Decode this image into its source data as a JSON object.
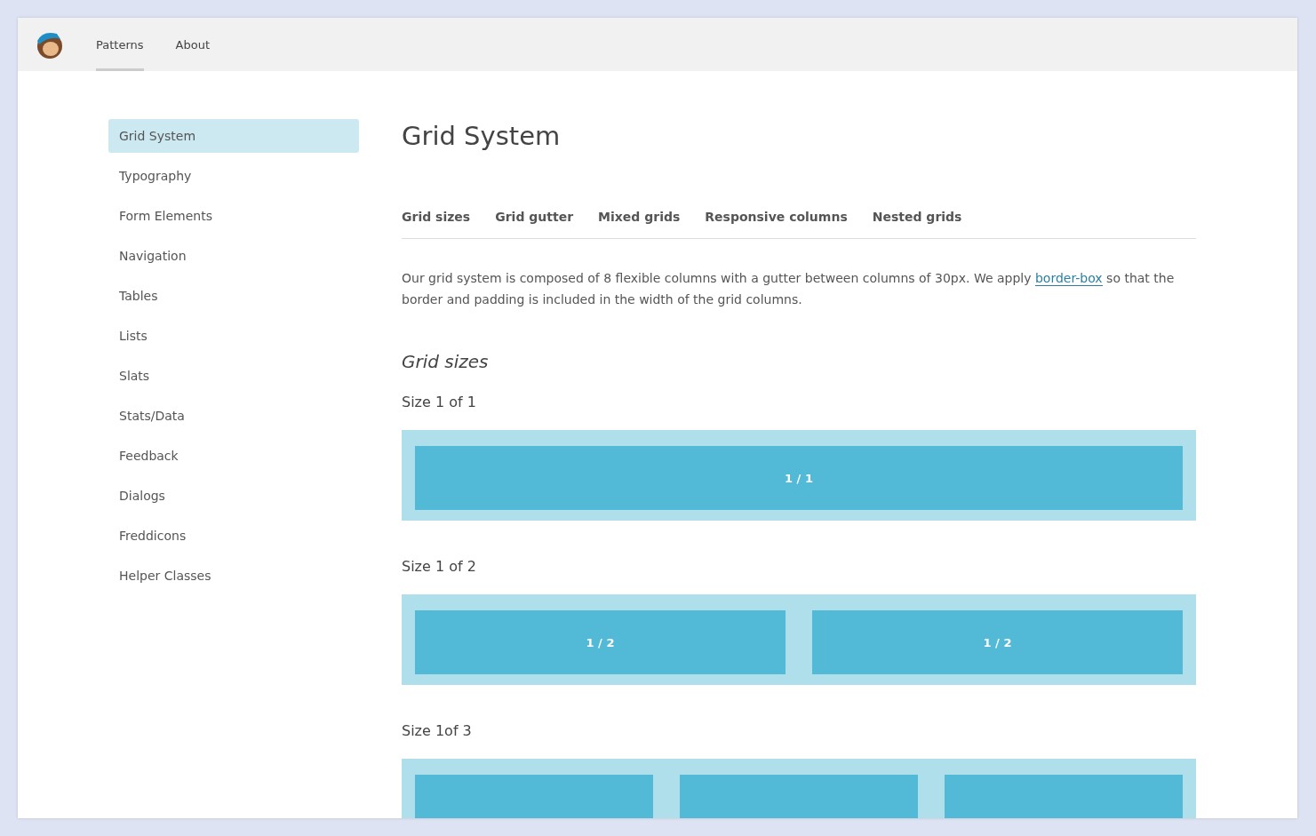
{
  "header": {
    "nav": [
      {
        "label": "Patterns",
        "selected": true
      },
      {
        "label": "About",
        "selected": false
      }
    ]
  },
  "sidebar": {
    "items": [
      {
        "label": "Grid System",
        "selected": true
      },
      {
        "label": "Typography",
        "selected": false
      },
      {
        "label": "Form Elements",
        "selected": false
      },
      {
        "label": "Navigation",
        "selected": false
      },
      {
        "label": "Tables",
        "selected": false
      },
      {
        "label": "Lists",
        "selected": false
      },
      {
        "label": "Slats",
        "selected": false
      },
      {
        "label": "Stats/Data",
        "selected": false
      },
      {
        "label": "Feedback",
        "selected": false
      },
      {
        "label": "Dialogs",
        "selected": false
      },
      {
        "label": "Freddicons",
        "selected": false
      },
      {
        "label": "Helper Classes",
        "selected": false
      }
    ]
  },
  "page": {
    "title": "Grid System",
    "subnav": [
      "Grid sizes",
      "Grid gutter",
      "Mixed grids",
      "Responsive columns",
      "Nested grids"
    ],
    "intro": {
      "before": "Our grid system is composed of 8 flexible columns with a gutter between columns of 30px. We apply ",
      "link": "border-box",
      "after": " so that the border and padding is included in the width of the grid columns."
    },
    "section_title": "Grid sizes",
    "grids": [
      {
        "title": "Size 1 of 1",
        "cells": [
          {
            "kind": "labeled",
            "label": "1 / 1"
          }
        ]
      },
      {
        "title": "Size 1 of 2",
        "cells": [
          {
            "kind": "labeled",
            "label": "1 / 2"
          },
          {
            "kind": "labeled",
            "label": "1 / 2"
          }
        ]
      },
      {
        "title": "Size 1of 3",
        "cells": [
          {
            "kind": "cut"
          },
          {
            "kind": "cut"
          },
          {
            "kind": "cut"
          }
        ]
      }
    ]
  }
}
